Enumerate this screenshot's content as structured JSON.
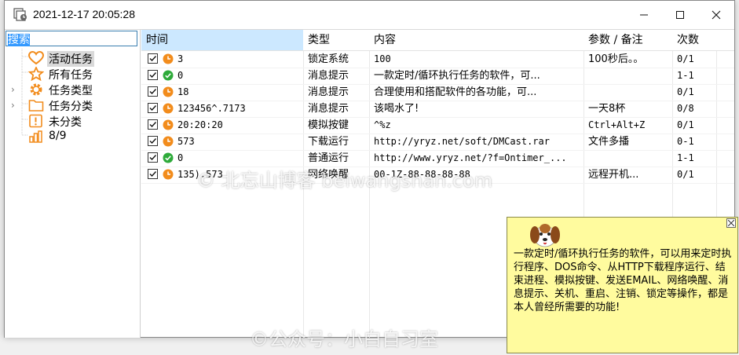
{
  "window": {
    "title": "2021-12-17 20:05:28",
    "minimize_glyph": "—",
    "maximize_glyph": "☐",
    "close_glyph": "✕"
  },
  "sidebar": {
    "search_value": "搜索",
    "items": [
      {
        "label": "活动任务",
        "icon": "heart-icon",
        "color": "#f39a1e"
      },
      {
        "label": "所有任务",
        "icon": "star-icon",
        "color": "#f39a1e"
      },
      {
        "label": "任务类型",
        "icon": "gear-icon",
        "color": "#f39a1e"
      },
      {
        "label": "任务分类",
        "icon": "folder-icon",
        "color": "#f39a1e"
      },
      {
        "label": "未分类",
        "icon": "exclamation-icon",
        "color": "#f39a1e"
      },
      {
        "label": "8/9",
        "icon": "bar-chart-icon",
        "color": "#f39a1e"
      }
    ]
  },
  "grid": {
    "columns": [
      "时间",
      "类型",
      "内容",
      "参数 / 备注",
      "次数"
    ],
    "rows": [
      {
        "time": "3",
        "status": "clock",
        "type": "锁定系统",
        "content": "100",
        "note": "100秒后。。",
        "count": "0/1"
      },
      {
        "time": "0",
        "status": "check",
        "type": "消息提示",
        "content": "一款定时/循环执行任务的软件，可...",
        "note": "",
        "count": "1-1"
      },
      {
        "time": "18",
        "status": "clock",
        "type": "消息提示",
        "content": "合理使用和搭配软件的各功能，可...",
        "note": "",
        "count": "0/1"
      },
      {
        "time": "123456^.7173",
        "status": "clock",
        "type": "消息提示",
        "content": "该喝水了!",
        "note": "一天8杯",
        "count": "0/8"
      },
      {
        "time": "20:20:20",
        "status": "clock",
        "type": "模拟按键",
        "content": "^%z",
        "note": "Ctrl+Alt+Z",
        "count": "0/1"
      },
      {
        "time": "573",
        "status": "clock",
        "type": "下载运行",
        "content": "http://yryz.net/soft/DMCast.rar",
        "note": "文件多播",
        "count": "0-1"
      },
      {
        "time": "0",
        "status": "check",
        "type": "普通运行",
        "content": "http://www.yryz.net/?f=Ontimer_...",
        "note": "",
        "count": "1-1"
      },
      {
        "time": "135).573",
        "status": "clock",
        "type": "网络唤醒",
        "content": "00-1Z-88-88-88-88",
        "note": "远程开机...",
        "count": "0/1"
      }
    ]
  },
  "popup": {
    "text": "一款定时/循环执行任务的软件，可以用来定时执行程序、DOS命令、从HTTP下载程序运行、结束进程、模拟按键、发送EMAIL、网络唤醒、消息提示、关机、重启、注销、锁定等操作，都是本人曾经所需要的功能!"
  },
  "watermarks": {
    "top": "© 北忘山博客 beiwangshan.com",
    "bottom": "©公众号：小白自习室"
  },
  "colors": {
    "accent_orange": "#f28c1c",
    "check_green": "#2eaa3a",
    "header_selected": "#cce8ff",
    "popup_bg": "#fffb9e"
  }
}
